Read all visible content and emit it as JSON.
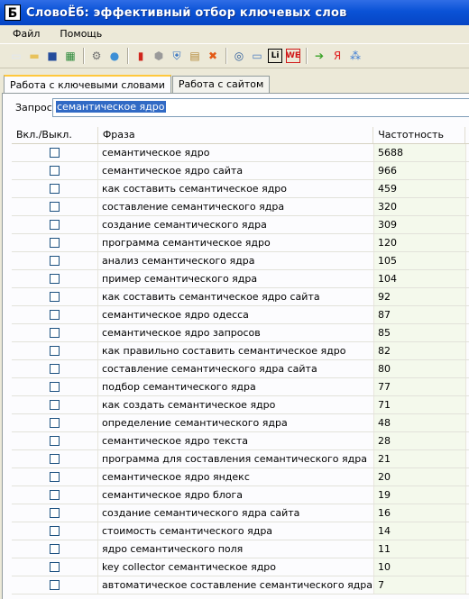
{
  "window": {
    "app_icon_letter": "Б",
    "title": "СловоЁб: эффективный отбор ключевых слов"
  },
  "menu": [
    "Файл",
    "Помощь"
  ],
  "toolbar": {
    "icons": [
      {
        "name": "new-file-icon",
        "glyph": "▭",
        "color": "#dfe8f3"
      },
      {
        "name": "open-folder-icon",
        "glyph": "▬",
        "color": "#e8c25b"
      },
      {
        "name": "save-icon",
        "glyph": "■",
        "color": "#244c9c"
      },
      {
        "name": "excel-export-icon",
        "glyph": "▦",
        "color": "#2d8a3a"
      },
      {
        "sep": true
      },
      {
        "name": "settings-gear-icon",
        "glyph": "⚙",
        "color": "#707070"
      },
      {
        "name": "globe-icon",
        "glyph": "●",
        "color": "#3d8fd6"
      },
      {
        "sep": true
      },
      {
        "name": "bar-chart-icon",
        "glyph": "▮",
        "color": "#d0261c"
      },
      {
        "name": "stop-hexagon-icon",
        "glyph": "⬢",
        "color": "#9a9a9a"
      },
      {
        "name": "shield-icon",
        "glyph": "⛨",
        "color": "#2f6fc1"
      },
      {
        "name": "clipboard-icon",
        "glyph": "▤",
        "color": "#b58a3a"
      },
      {
        "name": "delete-x-icon",
        "glyph": "✖",
        "color": "#e35a16"
      },
      {
        "sep": true
      },
      {
        "name": "magnifier-icon",
        "glyph": "◎",
        "color": "#2a5a9a"
      },
      {
        "name": "graph-window-icon",
        "glyph": "▭",
        "color": "#4a7cc0"
      },
      {
        "name": "li-counter-icon",
        "glyph": "Li",
        "color": "#000000"
      },
      {
        "name": "we-icon",
        "glyph": "WE",
        "color": "#d01818"
      },
      {
        "sep": true
      },
      {
        "name": "arrow-right-icon",
        "glyph": "➔",
        "color": "#3ca32a"
      },
      {
        "name": "yandex-icon",
        "glyph": "Я",
        "color": "#e02020"
      },
      {
        "name": "google-icon",
        "glyph": "⁂",
        "color": "#3a7bd5"
      }
    ]
  },
  "tabs": [
    {
      "label": "Работа с ключевыми словами",
      "active": true
    },
    {
      "label": "Работа с сайтом",
      "active": false
    }
  ],
  "query": {
    "label": "Запрос:",
    "value": "семантическое ядро"
  },
  "table": {
    "columns": [
      "Вкл./Выкл.",
      "Фраза",
      "Частотность"
    ],
    "rows": [
      {
        "phrase": "семантическое ядро",
        "freq": "5688",
        "checked": false
      },
      {
        "phrase": "семантическое ядро сайта",
        "freq": "966",
        "checked": false
      },
      {
        "phrase": "как составить семантическое ядро",
        "freq": "459",
        "checked": false
      },
      {
        "phrase": "составление семантического ядра",
        "freq": "320",
        "checked": false
      },
      {
        "phrase": "создание семантического ядра",
        "freq": "309",
        "checked": false
      },
      {
        "phrase": "программа семантическое ядро",
        "freq": "120",
        "checked": false
      },
      {
        "phrase": "анализ семантического ядра",
        "freq": "105",
        "checked": false
      },
      {
        "phrase": "пример семантического ядра",
        "freq": "104",
        "checked": false
      },
      {
        "phrase": "как составить семантическое ядро сайта",
        "freq": "92",
        "checked": false
      },
      {
        "phrase": "семантическое ядро одесса",
        "freq": "87",
        "checked": false
      },
      {
        "phrase": "семантическое ядро запросов",
        "freq": "85",
        "checked": false
      },
      {
        "phrase": "как правильно составить семантическое ядро",
        "freq": "82",
        "checked": false
      },
      {
        "phrase": "составление семантического ядра сайта",
        "freq": "80",
        "checked": false
      },
      {
        "phrase": "подбор семантического ядра",
        "freq": "77",
        "checked": false
      },
      {
        "phrase": "как создать семантическое ядро",
        "freq": "71",
        "checked": false
      },
      {
        "phrase": "определение семантического ядра",
        "freq": "48",
        "checked": false
      },
      {
        "phrase": "семантическое ядро текста",
        "freq": "28",
        "checked": false
      },
      {
        "phrase": "программа для составления семантического ядра",
        "freq": "21",
        "checked": false
      },
      {
        "phrase": "семантическое ядро яндекс",
        "freq": "20",
        "checked": false
      },
      {
        "phrase": "семантическое ядро блога",
        "freq": "19",
        "checked": false
      },
      {
        "phrase": "создание семантического ядра сайта",
        "freq": "16",
        "checked": false
      },
      {
        "phrase": "стоимость семантического ядра",
        "freq": "14",
        "checked": false
      },
      {
        "phrase": "ядро семантического поля",
        "freq": "11",
        "checked": false
      },
      {
        "phrase": "key collector семантическое ядро",
        "freq": "10",
        "checked": false
      },
      {
        "phrase": "автоматическое составление семантического ядра",
        "freq": "7",
        "checked": false
      }
    ]
  }
}
